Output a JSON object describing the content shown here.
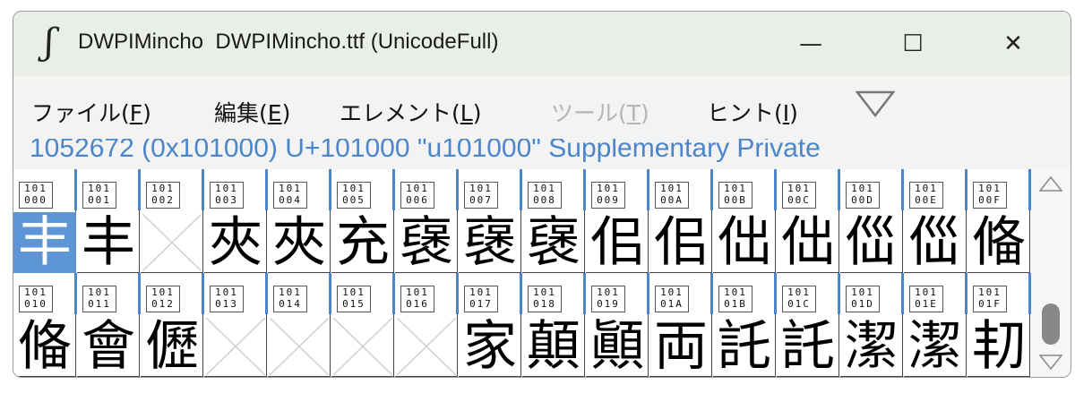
{
  "window": {
    "app_icon_glyph": "ʃ",
    "title": "DWPIMincho  DWPIMincho.ttf (UnicodeFull)",
    "minimize": "—",
    "maximize": "☐",
    "close": "✕"
  },
  "menu": {
    "items": [
      {
        "text": "ファイル(",
        "key": "F",
        "end": ")",
        "enabled": true
      },
      {
        "text": "編集(",
        "key": "E",
        "end": ")",
        "enabled": true
      },
      {
        "text": "エレメント(",
        "key": "L",
        "end": ")",
        "enabled": true
      },
      {
        "text": "ツール(",
        "key": "T",
        "end": ")",
        "enabled": false
      },
      {
        "text": "ヒント(",
        "key": "I",
        "end": ")",
        "enabled": true
      }
    ]
  },
  "info": {
    "text": "1052672 (0x101000) U+101000 \"u101000\" Supplementary Private"
  },
  "colors": {
    "accent": "#4a86c9",
    "selection": "#5d95d6"
  },
  "glyphs": [
    {
      "code": "101\n000",
      "glyph": "丰",
      "empty": false,
      "selected": true
    },
    {
      "code": "101\n001",
      "glyph": "丰",
      "empty": false
    },
    {
      "code": "101\n002",
      "glyph": "",
      "empty": true
    },
    {
      "code": "101\n003",
      "glyph": "夾",
      "empty": false
    },
    {
      "code": "101\n004",
      "glyph": "夾",
      "empty": false
    },
    {
      "code": "101\n005",
      "glyph": "充",
      "empty": false
    },
    {
      "code": "101\n006",
      "glyph": "襃",
      "empty": false
    },
    {
      "code": "101\n007",
      "glyph": "襃",
      "empty": false
    },
    {
      "code": "101\n008",
      "glyph": "襃",
      "empty": false
    },
    {
      "code": "101\n009",
      "glyph": "佀",
      "empty": false
    },
    {
      "code": "101\n00A",
      "glyph": "佀",
      "empty": false
    },
    {
      "code": "101\n00B",
      "glyph": "㑁",
      "empty": false
    },
    {
      "code": "101\n00C",
      "glyph": "㑁",
      "empty": false
    },
    {
      "code": "101\n00D",
      "glyph": "㑎",
      "empty": false
    },
    {
      "code": "101\n00E",
      "glyph": "㑎",
      "empty": false
    },
    {
      "code": "101\n00F",
      "glyph": "偹",
      "empty": false
    },
    {
      "code": "101\n010",
      "glyph": "偹",
      "empty": false
    },
    {
      "code": "101\n011",
      "glyph": "會",
      "empty": false
    },
    {
      "code": "101\n012",
      "glyph": "儮",
      "empty": false
    },
    {
      "code": "101\n013",
      "glyph": "",
      "empty": true
    },
    {
      "code": "101\n014",
      "glyph": "",
      "empty": true
    },
    {
      "code": "101\n015",
      "glyph": "",
      "empty": true
    },
    {
      "code": "101\n016",
      "glyph": "",
      "empty": true
    },
    {
      "code": "101\n017",
      "glyph": "家",
      "empty": false
    },
    {
      "code": "101\n018",
      "glyph": "顛",
      "empty": false
    },
    {
      "code": "101\n019",
      "glyph": "顚",
      "empty": false
    },
    {
      "code": "101\n01A",
      "glyph": "両",
      "empty": false
    },
    {
      "code": "101\n01B",
      "glyph": "託",
      "empty": false
    },
    {
      "code": "101\n01C",
      "glyph": "託",
      "empty": false
    },
    {
      "code": "101\n01D",
      "glyph": "潔",
      "empty": false
    },
    {
      "code": "101\n01E",
      "glyph": "潔",
      "empty": false
    },
    {
      "code": "101\n01F",
      "glyph": "㓞",
      "empty": false
    }
  ],
  "scrollbar": {
    "up_icon": "chevron-up",
    "down_icon": "chevron-down"
  }
}
